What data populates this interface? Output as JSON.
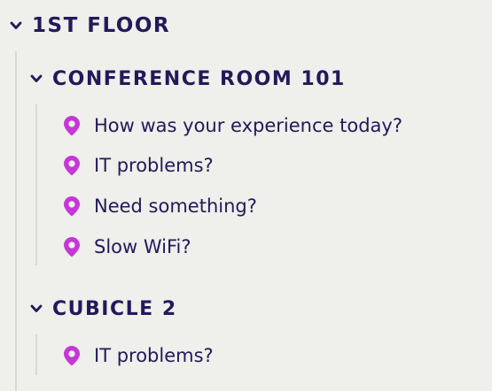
{
  "tree": {
    "floor": {
      "title": "1ST FLOOR",
      "rooms": [
        {
          "title": "CONFERENCE ROOM 101",
          "items": [
            "How was your experience today?",
            "IT problems?",
            "Need something?",
            "Slow WiFi?"
          ]
        },
        {
          "title": "CUBICLE 2",
          "items": [
            "IT problems?"
          ]
        }
      ]
    }
  },
  "colors": {
    "text": "#23195a",
    "pin": "#c537d6",
    "rail": "#d9d9d4",
    "background": "#efefeb"
  },
  "icons": {
    "expand": "chevron-down-icon",
    "item": "location-pin-icon"
  }
}
